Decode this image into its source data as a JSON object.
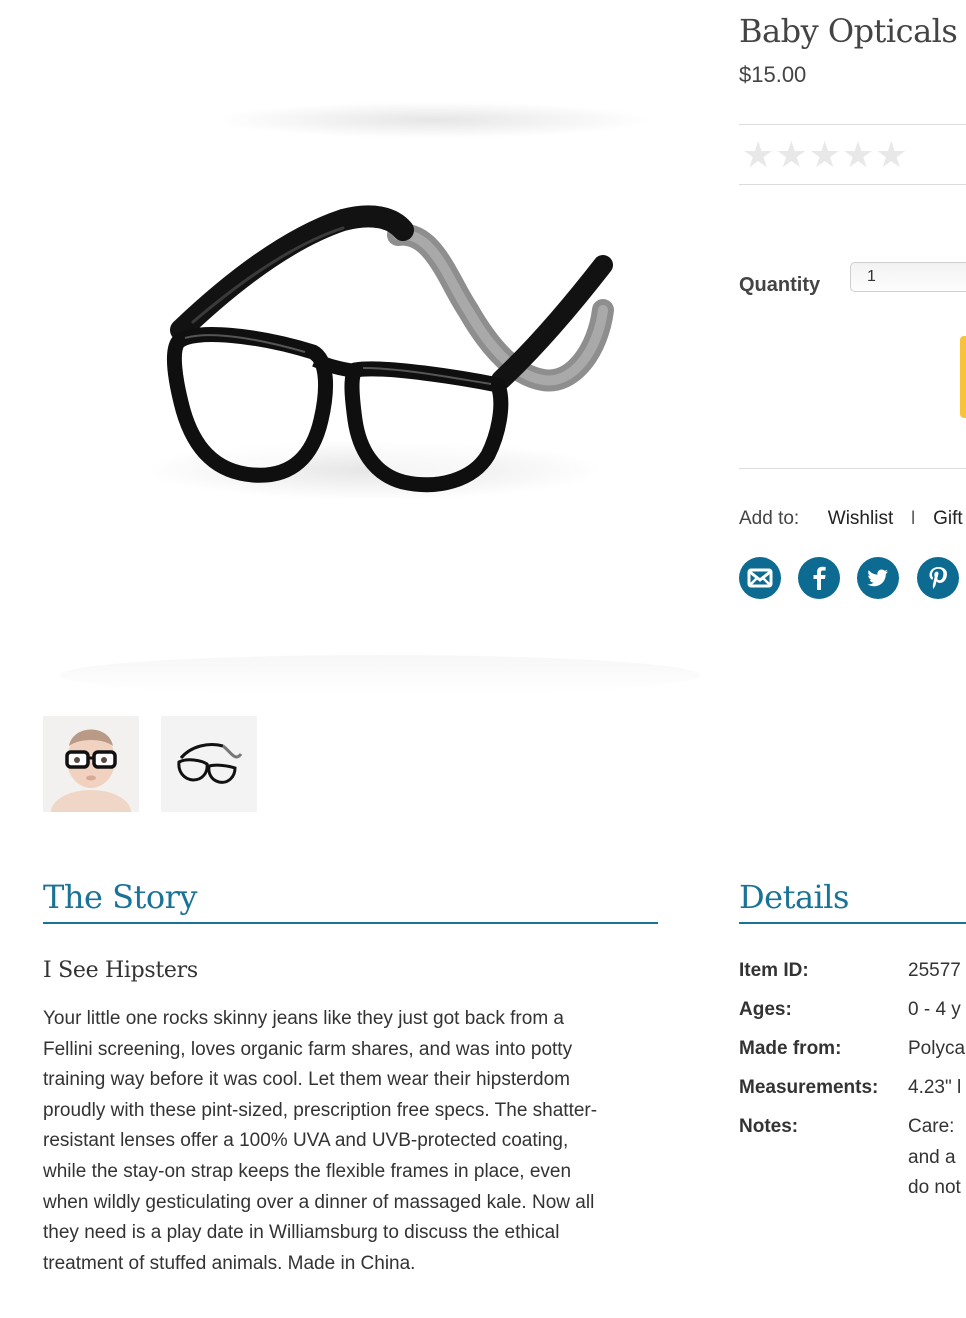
{
  "product": {
    "title": "Baby Opticals",
    "price": "$15.00",
    "rating_stars": 0,
    "rating_max": 5,
    "star_glyph": "★"
  },
  "purchase": {
    "quantity_label": "Quantity",
    "quantity_value": "1",
    "add_button_color": "#f8c33a"
  },
  "add_to": {
    "label": "Add to:",
    "wishlist": "Wishlist",
    "separator": "I",
    "gift": "Gift"
  },
  "share_icons": [
    "email-icon",
    "facebook-icon",
    "twitter-icon",
    "pinterest-icon"
  ],
  "story": {
    "heading": "The Story",
    "subheading": "I See Hipsters",
    "lines": [
      "Your little one rocks skinny jeans like they just got back from a",
      "Fellini screening, loves organic farm shares, and was into potty",
      "training way before it was cool. Let them wear their hipsterdom",
      "proudly with these pint-sized, prescription free specs. The shatter-",
      "resistant lenses offer a 100% UVA and UVB-protected coating,",
      "while the stay-on strap keeps the flexible frames in place, even",
      "when wildly gesticulating over a dinner of massaged kale. Now all",
      "they need is a play date in Williamsburg to discuss the ethical",
      "treatment of stuffed animals. Made in China."
    ]
  },
  "details": {
    "heading": "Details",
    "rows": [
      {
        "label": "Item ID:",
        "value": [
          "25577"
        ]
      },
      {
        "label": "Ages:",
        "value": [
          "0 - 4 y"
        ]
      },
      {
        "label": "Made from:",
        "value": [
          "Polyca"
        ]
      },
      {
        "label": "Measurements:",
        "value": [
          "4.23\" l"
        ]
      },
      {
        "label": "Notes:",
        "value": [
          "Care:",
          "and a",
          "do not"
        ]
      }
    ]
  },
  "colors": {
    "accent": "#1a7397",
    "social": "#0d6a90",
    "button": "#f8c33a"
  }
}
